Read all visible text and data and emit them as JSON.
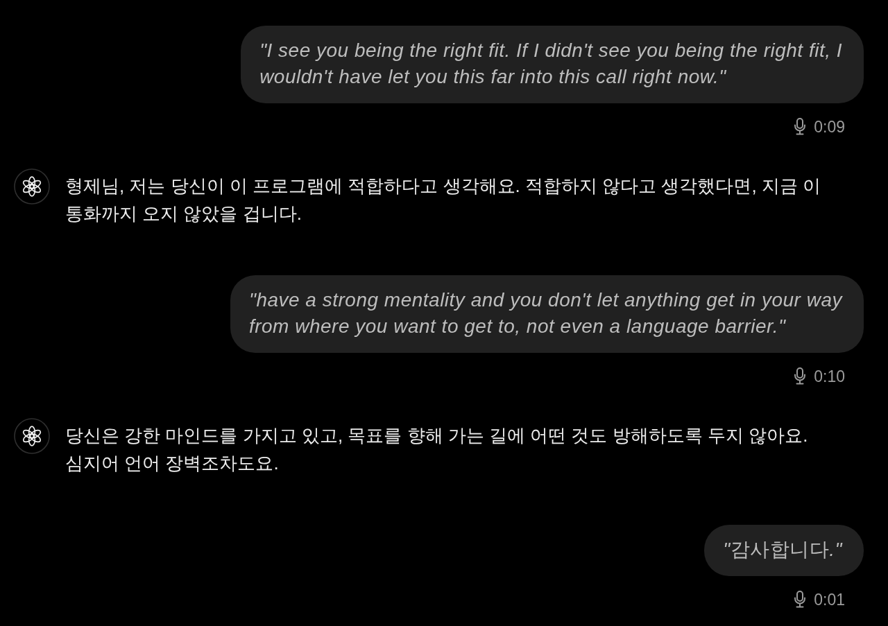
{
  "messages": [
    {
      "kind": "user",
      "lines": [
        "\"I see you being the right fit. If I didn't see you being the right fit, I",
        "wouldn't have let you this far into this call right now.\""
      ],
      "duration": "0:09"
    },
    {
      "kind": "assistant",
      "lines": [
        "형제님, 저는 당신이 이 프로그램에 적합하다고 생각해요. 적합하지 않다고 생각했다면, 지금 이",
        "통화까지 오지 않았을 겁니다."
      ]
    },
    {
      "kind": "user",
      "lines": [
        "\"have a strong mentality and you don't let anything get in your way",
        "from where you want to get to, not even a language barrier.\""
      ],
      "duration": "0:10"
    },
    {
      "kind": "assistant",
      "lines": [
        "당신은 강한 마인드를 가지고 있고, 목표를 향해 가는 길에 어떤 것도 방해하도록 두지 않아요.",
        "심지어 언어 장벽조차도요."
      ]
    },
    {
      "kind": "user",
      "lines": [
        "\"감사합니다.\""
      ],
      "duration": "0:01"
    }
  ]
}
